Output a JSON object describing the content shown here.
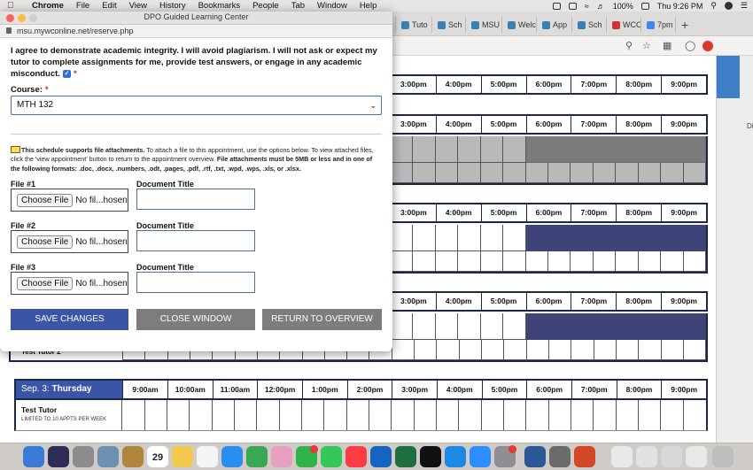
{
  "menubar": {
    "app": "Chrome",
    "items": [
      "File",
      "Edit",
      "View",
      "History",
      "Bookmarks",
      "People",
      "Tab",
      "Window",
      "Help"
    ],
    "battery": "100%",
    "clock": "Thu 9:26 PM"
  },
  "browser_tabs": [
    "Tuto",
    "Sch",
    "MSU",
    "Welc",
    "App",
    "Sch",
    "WCC",
    "7pm"
  ],
  "popup": {
    "title": "DPO Guided Learning Center",
    "url": "msu.mywconline.net/reserve.php",
    "agreement": "I agree to demonstrate academic integrity. I will avoid plagiarism. I will not ask or expect my tutor to complete assignments for me, provide test answers, or engage in any academic misconduct.",
    "course_label": "Course:",
    "course_value": "MTH 132",
    "attach_bold": "This schedule supports file attachments.",
    "attach_text": " To attach a file to this appointment, use the options below. To view attached files, click the 'view appointment' button to return to the appointment overview. ",
    "attach_bold2": "File attachments must be 5MB or less and in one of the following formats: .doc, .docx, .numbers, .odt, .pages, .pdf, .rtf, .txt, .wpd, .wps, .xls, or .xlsx.",
    "file1_label": "File #1",
    "file2_label": "File #2",
    "file3_label": "File #3",
    "doc_title_label": "Document Title",
    "choose_file": "Choose File",
    "no_file": "No fil...hosen",
    "buttons": {
      "save": "SAVE CHANGES",
      "close": "CLOSE WINDOW",
      "return": "RETURN TO OVERVIEW"
    },
    "colors": {
      "save_bg": "#3a55a8",
      "gray_bg": "#7d7d7d"
    }
  },
  "schedule": {
    "times_visible": [
      "3:00pm",
      "4:00pm",
      "5:00pm",
      "6:00pm",
      "7:00pm",
      "8:00pm",
      "9:00pm"
    ],
    "day": "Sep. 3:",
    "weekday": "Thursday",
    "day_times": [
      "9:00am",
      "10:00am",
      "11:00am",
      "12:00pm",
      "1:00pm",
      "2:00pm",
      "3:00pm",
      "4:00pm",
      "5:00pm",
      "6:00pm",
      "7:00pm",
      "8:00pm",
      "9:00pm"
    ],
    "tutor_name": "Test Tutor",
    "tutor_limit": "LIMITED TO 10 APPTS PER WEEK",
    "tutor2_partial": "Test Tutor 2",
    "colors": {
      "header_blue": "#3a55a8",
      "booked_navy": "#3e4378",
      "unavailable_gray": "#7b7b7b"
    }
  },
  "dock": {
    "calendar_day": "29"
  }
}
